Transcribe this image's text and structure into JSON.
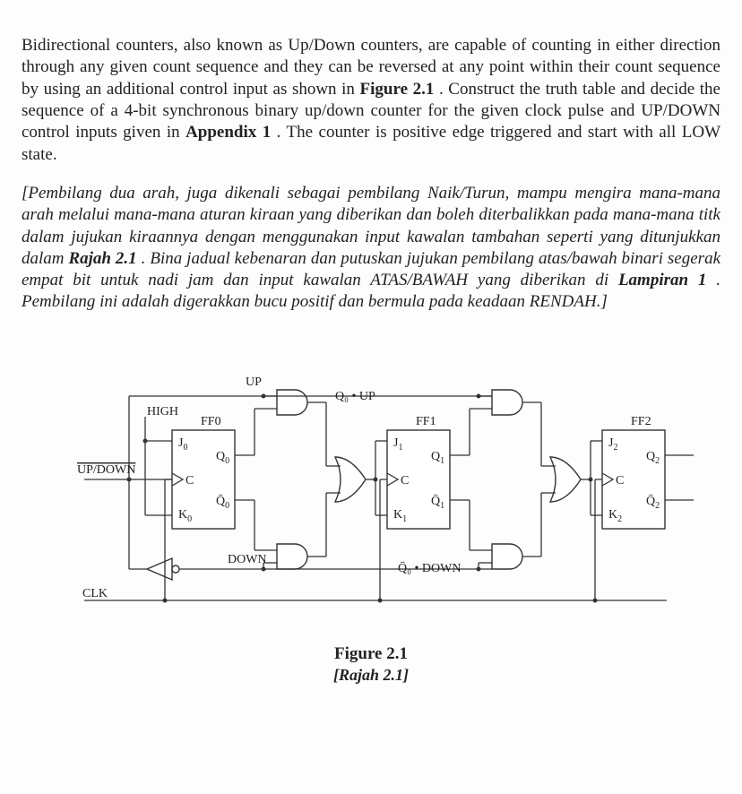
{
  "para_en_parts": {
    "a": "Bidirectional counters, also known as Up/Down counters, are capable of counting in either direction through any given count sequence and they can be reversed at any point within their count sequence by using an additional control input as shown in ",
    "fig": "Figure 2.1",
    "b": ". Construct the truth table and decide the sequence of a 4-bit synchronous binary up/down counter for the given clock pulse and UP/DOWN control inputs given in ",
    "app": "Appendix 1",
    "c": ". The counter is positive edge triggered and start with all LOW state."
  },
  "para_ms_parts": {
    "a": "[Pembilang dua arah, juga dikenali sebagai pembilang Naik/Turun, mampu mengira mana-mana arah melalui mana-mana aturan kiraan yang diberikan dan boleh diterbalikkan pada mana-mana titk dalam jujukan kiraannya dengan menggunakan input kawalan tambahan seperti yang ditunjukkan dalam ",
    "raj": "Rajah 2.1",
    "b": ". Bina jadual kebenaran dan putuskan jujukan pembilang atas/bawah binari segerak empat bit untuk nadi jam dan input kawalan ATAS/BAWAH yang diberikan di ",
    "lam": "Lampiran 1",
    "c": ". Pembilang ini adalah digerakkan bucu positif dan bermula pada keadaan RENDAH.]"
  },
  "diagram": {
    "up": "UP",
    "high": "HIGH",
    "down": "DOWN",
    "updown": "UP/DOWN",
    "clk": "CLK",
    "ff0": "FF0",
    "ff1": "FF1",
    "ff2": "FF2",
    "j0": "J",
    "j0s": "0",
    "k0": "K",
    "k0s": "0",
    "j1": "J",
    "j1s": "1",
    "k1": "K",
    "k1s": "1",
    "j2": "J",
    "j2s": "2",
    "k2": "K",
    "k2s": "2",
    "c": "C",
    "q0": "Q",
    "q0s": "0",
    "q0b": "Q̄",
    "q0bs": "0",
    "q1": "Q",
    "q1s": "1",
    "q1b": "Q̄",
    "q1bs": "1",
    "q2": "Q",
    "q2s": "2",
    "q2b": "Q̄",
    "q2bs": "2",
    "q0up": "Q₀ • UP",
    "q0down": "Q̄₀ • DOWN"
  },
  "caption": {
    "en": "Figure 2.1",
    "ms": "[Rajah 2.1]"
  }
}
